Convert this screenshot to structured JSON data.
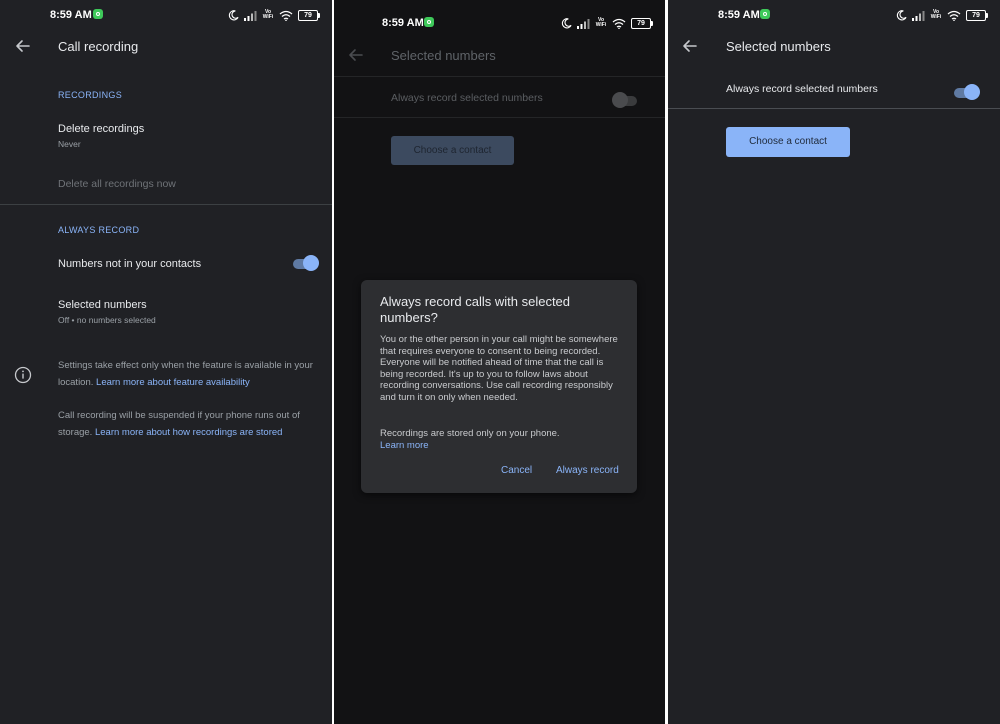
{
  "colors": {
    "background": "#202125",
    "dim_background": "#121214",
    "accent": "#8ab4f8",
    "text_primary": "#e8eaed",
    "text_secondary": "#9aa0a6",
    "dialog": "#2d2e31"
  },
  "status_bar": {
    "time": "8:59 AM",
    "battery": "79",
    "volte": "Vo",
    "wifi_label": "WiFi",
    "icons": [
      "whatsapp-icon",
      "moon-icon",
      "signal-icon",
      "volte-icon",
      "wifi-icon",
      "battery-icon"
    ]
  },
  "screen1": {
    "title": "Call recording",
    "recordings_header": "RECORDINGS",
    "delete_recordings": {
      "title": "Delete recordings",
      "value": "Never"
    },
    "delete_all": "Delete all recordings now",
    "always_record_header": "ALWAYS RECORD",
    "numbers_not_in_contacts": {
      "label": "Numbers not in your contacts",
      "enabled": true
    },
    "selected_numbers": {
      "title": "Selected numbers",
      "subtitle": "Off • no numbers selected"
    },
    "info1": {
      "text": "Settings take effect only when the feature is available in your location. ",
      "link": "Learn more about feature availability"
    },
    "info2": {
      "text": "Call recording will be suspended if your phone runs out of storage. ",
      "link": "Learn more about how recordings are stored"
    }
  },
  "screen2": {
    "title": "Selected numbers",
    "always_record_label": "Always record selected numbers",
    "toggle_enabled": false,
    "choose_contact": "Choose a contact",
    "dialog": {
      "title": "Always record calls with selected numbers?",
      "body": "You or the other person in your call might be somewhere that requires everyone to consent to being recorded. Everyone will be notified ahead of time that the call is being recorded. It's up to you to follow laws about recording conversations. Use call recording responsibly and turn it on only when needed.",
      "storage_note": "Recordings are stored only on your phone.",
      "learn_more": "Learn more",
      "cancel": "Cancel",
      "confirm": "Always record"
    }
  },
  "screen3": {
    "title": "Selected numbers",
    "always_record_label": "Always record selected numbers",
    "toggle_enabled": true,
    "choose_contact": "Choose a contact"
  }
}
